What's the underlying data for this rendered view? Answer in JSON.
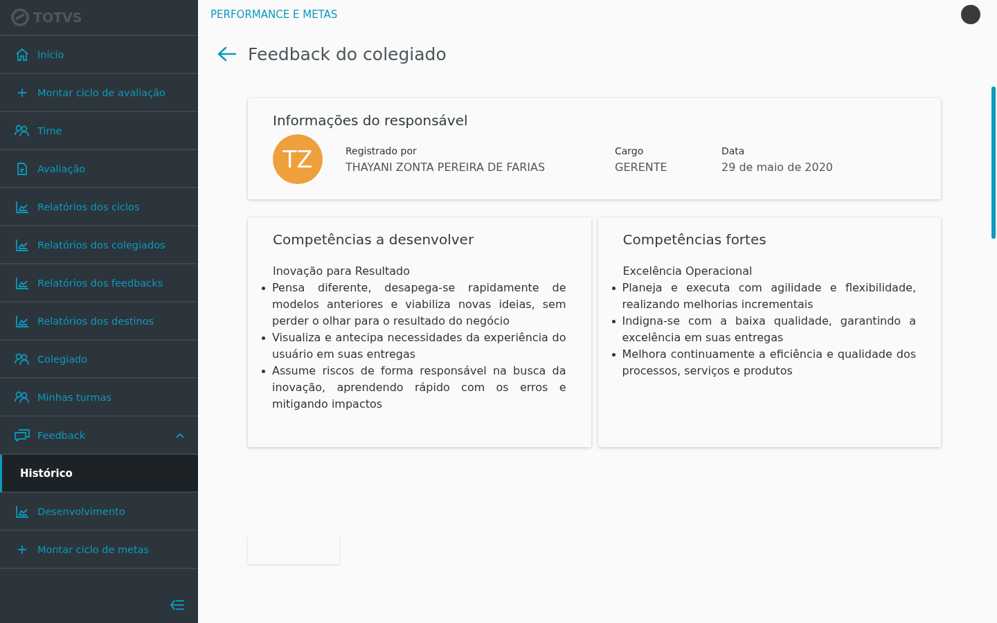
{
  "sidebar": {
    "logo": "TOTVS",
    "items": [
      {
        "label": "Início",
        "kind": "home",
        "selected": false
      },
      {
        "label": "Montar ciclo de avaliação",
        "kind": "plus",
        "selected": false
      },
      {
        "label": "Time",
        "kind": "people",
        "selected": false
      },
      {
        "label": "Avaliação",
        "kind": "document",
        "selected": false
      },
      {
        "label": "Relatórios dos ciclos",
        "kind": "chart",
        "selected": false
      },
      {
        "label": "Relatórios dos colegiados",
        "kind": "chart",
        "selected": false
      },
      {
        "label": "Relatórios dos feedbacks",
        "kind": "chart",
        "selected": false
      },
      {
        "label": "Relatórios dos destinos",
        "kind": "chart",
        "selected": false
      },
      {
        "label": "Colegiado",
        "kind": "people",
        "selected": false
      },
      {
        "label": "Minhas turmas",
        "kind": "people",
        "selected": false
      },
      {
        "label": "Feedback",
        "kind": "chat",
        "selected": false,
        "expanded": true,
        "children": [
          {
            "label": "Histórico",
            "selected": true
          }
        ]
      },
      {
        "label": "Desenvolvimento",
        "kind": "chart",
        "selected": false
      },
      {
        "label": "Montar ciclo de metas",
        "kind": "plus",
        "selected": false
      }
    ]
  },
  "header": {
    "app_title": "PERFORMANCE E METAS"
  },
  "page": {
    "title": "Feedback do colegiado"
  },
  "responsible_card": {
    "title": "Informações do responsável",
    "initials": "TZ",
    "fields": [
      {
        "label": "Registrado por",
        "value": "THAYANI ZONTA PEREIRA DE FARIAS"
      },
      {
        "label": "Cargo",
        "value": "GERENTE"
      },
      {
        "label": "Data",
        "value": "29 de maio de 2020"
      }
    ]
  },
  "competency_cards": [
    {
      "title": "Competências a desenvolver",
      "competency": "Inovação para Resultado",
      "bullets": [
        "Pensa diferente, desapega-se rapidamente de modelos anteriores e viabiliza novas ideias, sem perder o olhar para o resultado do negócio",
        "Visualiza e antecipa necessidades da experiência do usuário em suas entregas",
        "Assume riscos de forma responsável na busca da inovação, aprendendo rápido com os erros e mitigando impactos"
      ]
    },
    {
      "title": "Competências fortes",
      "competency": "Excelência Operacional",
      "bullets": [
        "Planeja e executa com agilidade e flexibilidade, realizando melhorias incrementais",
        "Indigna-se com a baixa qualidade, garantindo a excelência em suas entregas",
        "Melhora continuamente a eficiência e qualidade dos processos, serviços e produtos"
      ]
    }
  ]
}
